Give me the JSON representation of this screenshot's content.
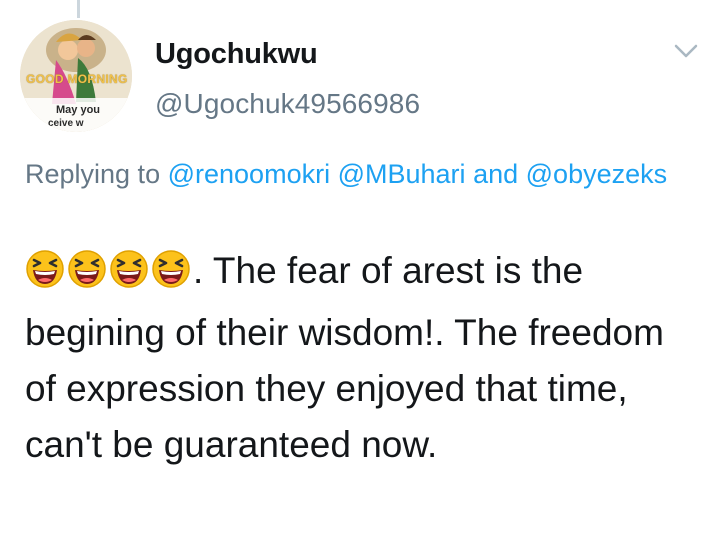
{
  "tweet": {
    "author": {
      "display_name": "Ugochukwu",
      "handle": "@Ugochuk49566986",
      "avatar": {
        "text_line1": "GOOD MORNING",
        "text_line2": "May you",
        "text_line3": "ceive w"
      }
    },
    "menu_icon": "chevron-down-icon",
    "reply": {
      "prefix": "Replying to",
      "mentions": [
        "@renoomokri",
        "@MBuhari",
        "@obyezeks"
      ],
      "joiner": "and"
    },
    "emoji": {
      "name": "grinning-squinting-face",
      "count": 4
    },
    "body_text": ". The fear of arest is the begining of their wisdom!. The freedom of expression they enjoyed that time, can't be guaranteed now."
  },
  "colors": {
    "text_primary": "#14171a",
    "text_secondary": "#657786",
    "link": "#1da1f2",
    "divider": "#ccd6dd"
  }
}
